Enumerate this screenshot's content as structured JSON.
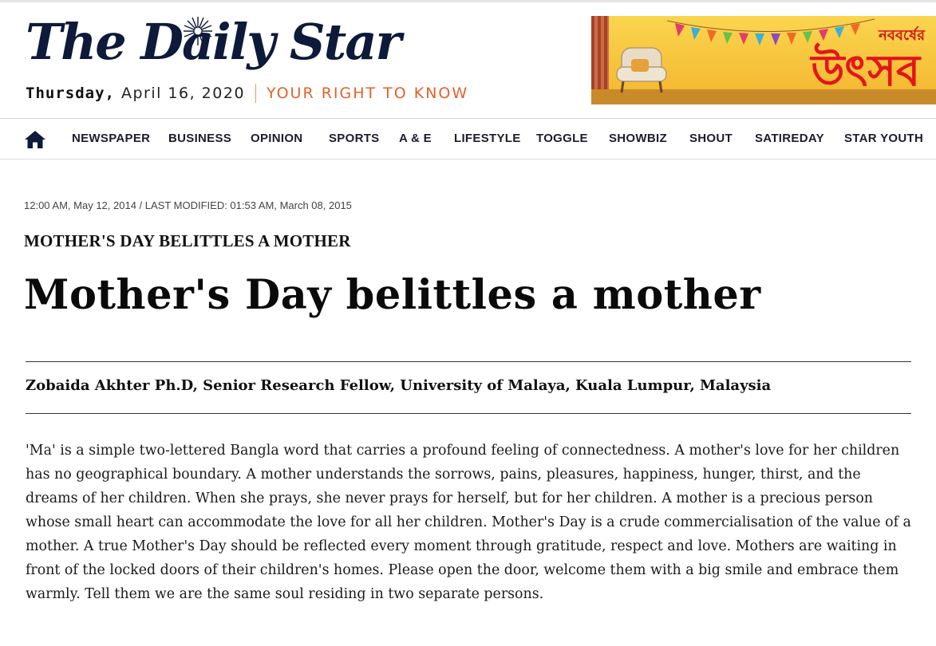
{
  "header": {
    "logo_text": "The Daily Star",
    "date_day": "Thursday,",
    "date_rest": "April 16, 2020",
    "tagline": "YOUR RIGHT TO KNOW",
    "banner": {
      "top_text": "নববর্ষের",
      "main_text": "উৎসব"
    }
  },
  "nav": {
    "home_icon": "home-icon",
    "items": [
      "NEWSPAPER",
      "BUSINESS",
      "OPINION",
      "SPORTS",
      "A & E",
      "LIFESTYLE",
      "TOGGLE",
      "SHOWBIZ",
      "SHOUT",
      "SATIREDAY",
      "STAR YOUTH"
    ]
  },
  "article": {
    "timestamp": "12:00 AM, May 12, 2014 / LAST MODIFIED: 01:53 AM, March 08, 2015",
    "kicker": "MOTHER'S DAY BELITTLES A MOTHER",
    "headline": "Mother's Day belittles a mother",
    "byline": "Zobaida Akhter Ph.D, Senior Research Fellow, University of Malaya, Kuala Lumpur, Malaysia",
    "body": "'Ma' is a simple two-lettered Bangla word that carries a profound feeling of connectedness. A mother's love for her children has no geographical boundary. A mother understands the sorrows, pains, pleasures, happiness, hunger, thirst, and the dreams of her children. When she prays, she never prays for herself, but for her children. A mother is a precious person whose small heart can accommodate the love for all her children. Mother's Day is a crude commercialisation of the value of a mother. A true Mother's Day should be reflected every moment through gratitude, respect and love. Mothers are waiting in front of the locked doors of their children's homes. Please open the door, welcome them with a big smile and embrace them warmly. Tell them we are the same soul residing in two separate persons."
  },
  "colors": {
    "logo": "#0d1a3a",
    "tagline": "#e3612b",
    "banner_red": "#e1161c",
    "banner_yellow": "#f8c93b",
    "nav_text": "#1c1c2c"
  }
}
